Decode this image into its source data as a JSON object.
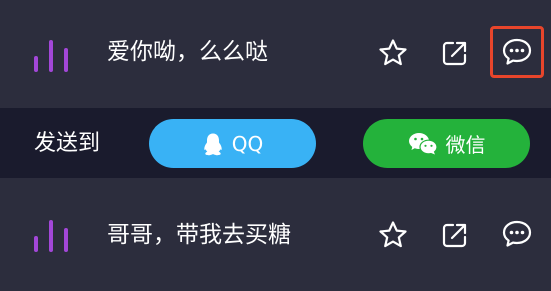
{
  "songs": [
    {
      "title": "爱你呦，么么哒"
    },
    {
      "title": "哥哥，带我去买糖"
    }
  ],
  "share_bar": {
    "label": "发送到",
    "qq_label": "QQ",
    "wechat_label": "微信"
  },
  "icons": {
    "playing": "equalizer-bars-icon",
    "favorite": "star-icon",
    "share": "share-arrow-icon",
    "comment": "chat-bubble-icon",
    "qq": "qq-penguin-icon",
    "wechat": "wechat-icon"
  },
  "colors": {
    "background": "#2c2d3d",
    "share_bar_background": "#1a1b2d",
    "playing_indicator": "#a347d9",
    "qq_button": "#39b2f5",
    "wechat_button": "#24b23b",
    "highlight_border": "#e8452b"
  }
}
